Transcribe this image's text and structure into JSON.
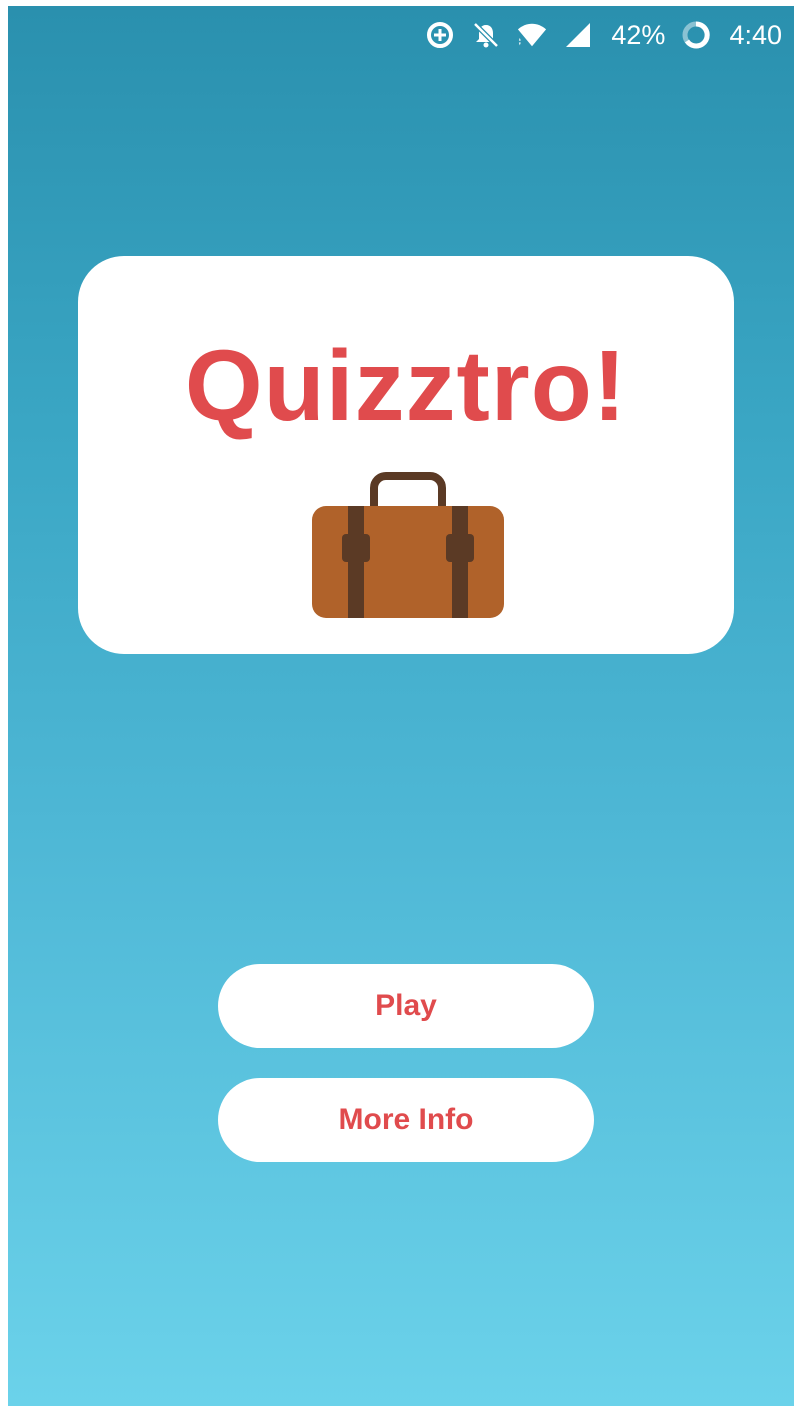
{
  "status_bar": {
    "icons": [
      "data-saver-icon",
      "notifications-off-icon",
      "wifi-icon",
      "cell-signal-icon",
      "battery-icon"
    ],
    "battery_percent": "42%",
    "time": "4:40"
  },
  "title_card": {
    "title": "Quizztro!",
    "image": "suitcase-icon"
  },
  "buttons": {
    "play_label": "Play",
    "more_info_label": "More Info"
  },
  "colors": {
    "accent": "#e04b4d",
    "background_top": "#2a90ae",
    "background_bottom": "#6bd2ea",
    "card": "#ffffff",
    "suitcase_body": "#b0622a",
    "suitcase_strap": "#5b3a25"
  }
}
